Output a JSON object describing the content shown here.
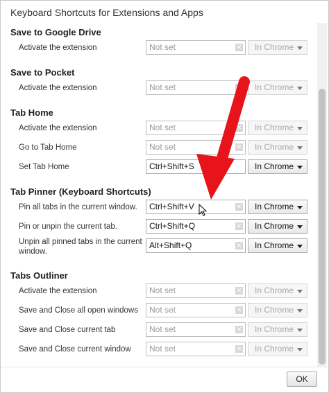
{
  "dialog": {
    "title": "Keyboard Shortcuts for Extensions and Apps",
    "ok_label": "OK"
  },
  "sections": [
    {
      "title": "Save to Google Drive",
      "rows": [
        {
          "label": "Activate the extension",
          "shortcut": "Not set",
          "scope": "In Chrome",
          "set": false
        }
      ]
    },
    {
      "title": "Save to Pocket",
      "rows": [
        {
          "label": "Activate the extension",
          "shortcut": "Not set",
          "scope": "In Chrome",
          "set": false
        }
      ]
    },
    {
      "title": "Tab Home",
      "rows": [
        {
          "label": "Activate the extension",
          "shortcut": "Not set",
          "scope": "In Chrome",
          "set": false
        },
        {
          "label": "Go to Tab Home",
          "shortcut": "Not set",
          "scope": "In Chrome",
          "set": false
        },
        {
          "label": "Set Tab Home",
          "shortcut": "Ctrl+Shift+S",
          "scope": "In Chrome",
          "set": true
        }
      ]
    },
    {
      "title": "Tab Pinner (Keyboard Shortcuts)",
      "rows": [
        {
          "label": "Pin all tabs in the current window.",
          "shortcut": "Ctrl+Shift+V",
          "scope": "In Chrome",
          "set": true
        },
        {
          "label": "Pin or unpin the current tab.",
          "shortcut": "Ctrl+Shift+Q",
          "scope": "In Chrome",
          "set": true
        },
        {
          "label": "Unpin all pinned tabs in the current window.",
          "shortcut": "Alt+Shift+Q",
          "scope": "In Chrome",
          "set": true
        }
      ]
    },
    {
      "title": "Tabs Outliner",
      "rows": [
        {
          "label": "Activate the extension",
          "shortcut": "Not set",
          "scope": "In Chrome",
          "set": false
        },
        {
          "label": "Save and Close all open windows",
          "shortcut": "Not set",
          "scope": "In Chrome",
          "set": false
        },
        {
          "label": "Save and Close current tab",
          "shortcut": "Not set",
          "scope": "In Chrome",
          "set": false
        },
        {
          "label": "Save and Close current window",
          "shortcut": "Not set",
          "scope": "In Chrome",
          "set": false
        }
      ]
    }
  ],
  "icons": {
    "clear": "clear-x-icon",
    "dropdown": "chevron-down-icon",
    "cursor": "mouse-pointer-icon",
    "annotation": "red-arrow-icon"
  },
  "colors": {
    "annotation_arrow": "#e8141c"
  }
}
